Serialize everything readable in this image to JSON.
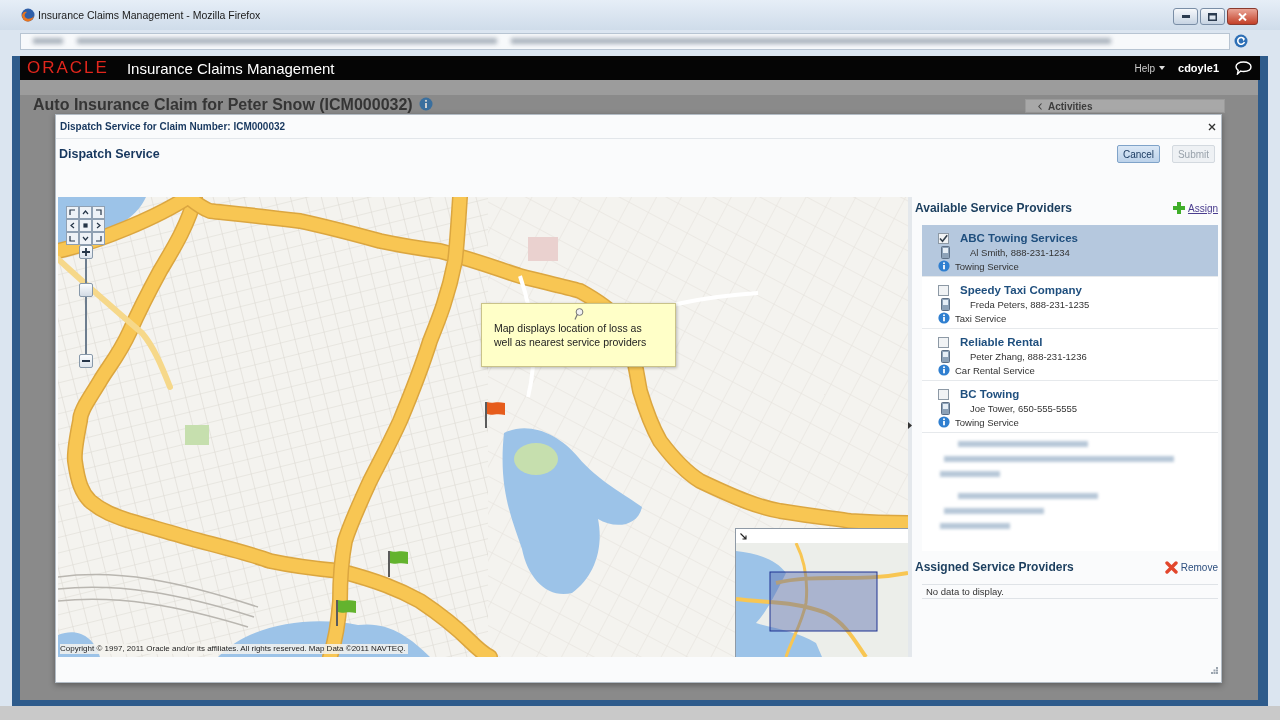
{
  "browser": {
    "title": "Insurance Claims Management - Mozilla Firefox"
  },
  "app_header": {
    "brand": "ORACLE",
    "product": "Insurance Claims Management",
    "help": "Help",
    "user": "cdoyle1"
  },
  "page": {
    "title": "Auto Insurance Claim for Peter Snow (ICM000032)",
    "side_panel": "Activities"
  },
  "dialog": {
    "title": "Dispatch Service for Claim Number: ICM000032",
    "heading": "Dispatch Service",
    "buttons": [
      {
        "label": "Cancel",
        "focused": true,
        "disabled": false
      },
      {
        "label": "Submit",
        "focused": false,
        "disabled": true
      }
    ]
  },
  "map": {
    "zoom": {
      "level": 0.7
    },
    "tooltip": "Map displays location of loss as well as nearest service providers",
    "markers": [
      {
        "color": "#e65c1c"
      },
      {
        "color": "#63b32e"
      },
      {
        "color": "#63b32e"
      }
    ],
    "copyright": "Copyright © 1997, 2011 Oracle and/or its affiliates. All rights reserved. Map Data ©2011 NAVTEQ."
  },
  "available_providers": {
    "title": "Available Service Providers",
    "action": "Assign",
    "items": [
      {
        "name": "ABC Towing Services",
        "contact": "Al Smith, 888-231-1234",
        "type": "Towing Service",
        "selected": true,
        "checked": true
      },
      {
        "name": "Speedy Taxi Company",
        "contact": "Freda Peters, 888-231-1235",
        "type": "Taxi Service",
        "selected": false,
        "checked": false
      },
      {
        "name": "Reliable Rental",
        "contact": "Peter Zhang, 888-231-1236",
        "type": "Car Rental Service",
        "selected": false,
        "checked": false
      },
      {
        "name": "BC Towing",
        "contact": "Joe Tower, 650-555-5555",
        "type": "Towing Service",
        "selected": false,
        "checked": false
      }
    ]
  },
  "assigned_providers": {
    "title": "Assigned Service Providers",
    "action": "Remove",
    "empty_text": "No data to display."
  }
}
